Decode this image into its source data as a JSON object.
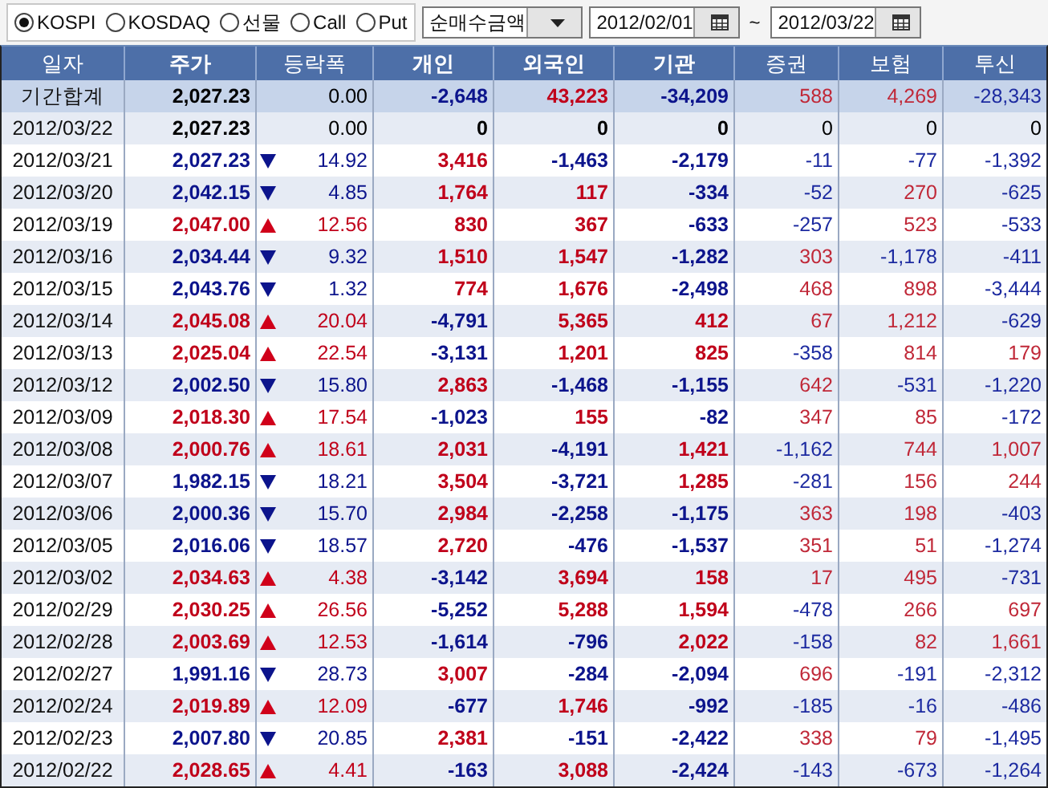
{
  "toolbar": {
    "markets": [
      {
        "label": "KOSPI",
        "selected": true
      },
      {
        "label": "KOSDAQ",
        "selected": false
      },
      {
        "label": "선물",
        "selected": false
      },
      {
        "label": "Call",
        "selected": false
      },
      {
        "label": "Put",
        "selected": false
      }
    ],
    "dropdown": {
      "value": "순매수금액"
    },
    "date_from": "2012/02/01",
    "separator": "~",
    "date_to": "2012/03/22"
  },
  "table": {
    "columns": [
      "일자",
      "주가",
      "등락폭",
      "개인",
      "외국인",
      "기관",
      "증권",
      "보험",
      "투신"
    ],
    "rows": [
      {
        "kind": "total",
        "date": "기간합계",
        "price": "2,027.23",
        "up": false,
        "down": false,
        "change": "0.00",
        "individual": "-2,648",
        "foreign": "43,223",
        "institution": "-34,209",
        "securities": "588",
        "insurance": "4,269",
        "investment_trust": "-28,343"
      },
      {
        "kind": "day",
        "date": "2012/03/22",
        "price": "2,027.23",
        "up": false,
        "down": false,
        "change": "0.00",
        "individual": "0",
        "foreign": "0",
        "institution": "0",
        "securities": "0",
        "insurance": "0",
        "investment_trust": "0"
      },
      {
        "kind": "day",
        "date": "2012/03/21",
        "price": "2,027.23",
        "up": false,
        "down": true,
        "change": "14.92",
        "individual": "3,416",
        "foreign": "-1,463",
        "institution": "-2,179",
        "securities": "-11",
        "insurance": "-77",
        "investment_trust": "-1,392"
      },
      {
        "kind": "day",
        "date": "2012/03/20",
        "price": "2,042.15",
        "up": false,
        "down": true,
        "change": "4.85",
        "individual": "1,764",
        "foreign": "117",
        "institution": "-334",
        "securities": "-52",
        "insurance": "270",
        "investment_trust": "-625"
      },
      {
        "kind": "day",
        "date": "2012/03/19",
        "price": "2,047.00",
        "up": true,
        "down": false,
        "change": "12.56",
        "individual": "830",
        "foreign": "367",
        "institution": "-633",
        "securities": "-257",
        "insurance": "523",
        "investment_trust": "-533"
      },
      {
        "kind": "day",
        "date": "2012/03/16",
        "price": "2,034.44",
        "up": false,
        "down": true,
        "change": "9.32",
        "individual": "1,510",
        "foreign": "1,547",
        "institution": "-1,282",
        "securities": "303",
        "insurance": "-1,178",
        "investment_trust": "-411"
      },
      {
        "kind": "day",
        "date": "2012/03/15",
        "price": "2,043.76",
        "up": false,
        "down": true,
        "change": "1.32",
        "individual": "774",
        "foreign": "1,676",
        "institution": "-2,498",
        "securities": "468",
        "insurance": "898",
        "investment_trust": "-3,444"
      },
      {
        "kind": "day",
        "date": "2012/03/14",
        "price": "2,045.08",
        "up": true,
        "down": false,
        "change": "20.04",
        "individual": "-4,791",
        "foreign": "5,365",
        "institution": "412",
        "securities": "67",
        "insurance": "1,212",
        "investment_trust": "-629"
      },
      {
        "kind": "day",
        "date": "2012/03/13",
        "price": "2,025.04",
        "up": true,
        "down": false,
        "change": "22.54",
        "individual": "-3,131",
        "foreign": "1,201",
        "institution": "825",
        "securities": "-358",
        "insurance": "814",
        "investment_trust": "179"
      },
      {
        "kind": "day",
        "date": "2012/03/12",
        "price": "2,002.50",
        "up": false,
        "down": true,
        "change": "15.80",
        "individual": "2,863",
        "foreign": "-1,468",
        "institution": "-1,155",
        "securities": "642",
        "insurance": "-531",
        "investment_trust": "-1,220"
      },
      {
        "kind": "day",
        "date": "2012/03/09",
        "price": "2,018.30",
        "up": true,
        "down": false,
        "change": "17.54",
        "individual": "-1,023",
        "foreign": "155",
        "institution": "-82",
        "securities": "347",
        "insurance": "85",
        "investment_trust": "-172"
      },
      {
        "kind": "day",
        "date": "2012/03/08",
        "price": "2,000.76",
        "up": true,
        "down": false,
        "change": "18.61",
        "individual": "2,031",
        "foreign": "-4,191",
        "institution": "1,421",
        "securities": "-1,162",
        "insurance": "744",
        "investment_trust": "1,007"
      },
      {
        "kind": "day",
        "date": "2012/03/07",
        "price": "1,982.15",
        "up": false,
        "down": true,
        "change": "18.21",
        "individual": "3,504",
        "foreign": "-3,721",
        "institution": "1,285",
        "securities": "-281",
        "insurance": "156",
        "investment_trust": "244"
      },
      {
        "kind": "day",
        "date": "2012/03/06",
        "price": "2,000.36",
        "up": false,
        "down": true,
        "change": "15.70",
        "individual": "2,984",
        "foreign": "-2,258",
        "institution": "-1,175",
        "securities": "363",
        "insurance": "198",
        "investment_trust": "-403"
      },
      {
        "kind": "day",
        "date": "2012/03/05",
        "price": "2,016.06",
        "up": false,
        "down": true,
        "change": "18.57",
        "individual": "2,720",
        "foreign": "-476",
        "institution": "-1,537",
        "securities": "351",
        "insurance": "51",
        "investment_trust": "-1,274"
      },
      {
        "kind": "day",
        "date": "2012/03/02",
        "price": "2,034.63",
        "up": true,
        "down": false,
        "change": "4.38",
        "individual": "-3,142",
        "foreign": "3,694",
        "institution": "158",
        "securities": "17",
        "insurance": "495",
        "investment_trust": "-731"
      },
      {
        "kind": "day",
        "date": "2012/02/29",
        "price": "2,030.25",
        "up": true,
        "down": false,
        "change": "26.56",
        "individual": "-5,252",
        "foreign": "5,288",
        "institution": "1,594",
        "securities": "-478",
        "insurance": "266",
        "investment_trust": "697"
      },
      {
        "kind": "day",
        "date": "2012/02/28",
        "price": "2,003.69",
        "up": true,
        "down": false,
        "change": "12.53",
        "individual": "-1,614",
        "foreign": "-796",
        "institution": "2,022",
        "securities": "-158",
        "insurance": "82",
        "investment_trust": "1,661"
      },
      {
        "kind": "day",
        "date": "2012/02/27",
        "price": "1,991.16",
        "up": false,
        "down": true,
        "change": "28.73",
        "individual": "3,007",
        "foreign": "-284",
        "institution": "-2,094",
        "securities": "696",
        "insurance": "-191",
        "investment_trust": "-2,312"
      },
      {
        "kind": "day",
        "date": "2012/02/24",
        "price": "2,019.89",
        "up": true,
        "down": false,
        "change": "12.09",
        "individual": "-677",
        "foreign": "1,746",
        "institution": "-992",
        "securities": "-185",
        "insurance": "-16",
        "investment_trust": "-486"
      },
      {
        "kind": "day",
        "date": "2012/02/23",
        "price": "2,007.80",
        "up": false,
        "down": true,
        "change": "20.85",
        "individual": "2,381",
        "foreign": "-151",
        "institution": "-2,422",
        "securities": "338",
        "insurance": "79",
        "investment_trust": "-1,495"
      },
      {
        "kind": "day",
        "date": "2012/02/22",
        "price": "2,028.65",
        "up": true,
        "down": false,
        "change": "4.41",
        "individual": "-163",
        "foreign": "3,088",
        "institution": "-2,424",
        "securities": "-143",
        "insurance": "-673",
        "investment_trust": "-1,264"
      }
    ]
  }
}
